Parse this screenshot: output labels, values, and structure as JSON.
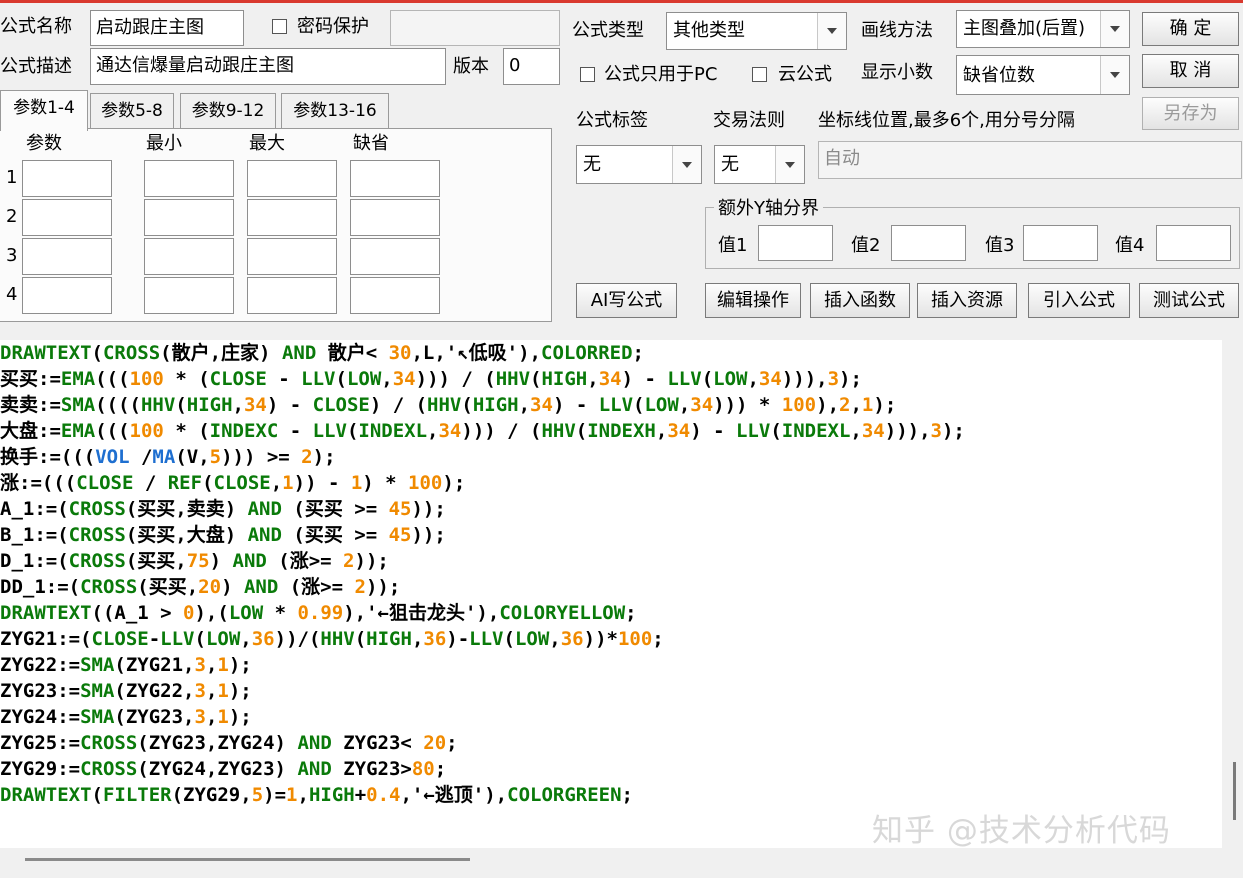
{
  "header": {
    "name_label": "公式名称",
    "name_value": "启动跟庄主图",
    "password_label": "密码保护",
    "desc_label": "公式描述",
    "desc_value": "通达信爆量启动跟庄主图",
    "version_label": "版本",
    "version_value": "0"
  },
  "right_panel": {
    "type_label": "公式类型",
    "type_value": "其他类型",
    "draw_label": "画线方法",
    "draw_value": "主图叠加(后置)",
    "pc_only_label": "公式只用于PC",
    "cloud_label": "云公式",
    "decimals_label": "显示小数",
    "decimals_value": "缺省位数",
    "tag_label": "公式标签",
    "tag_value": "无",
    "rule_label": "交易法则",
    "rule_value": "无",
    "coord_label": "坐标线位置,最多6个,用分号分隔",
    "coord_value": "自动",
    "yaxis_legend": "额外Y轴分界",
    "y1_label": "值1",
    "y2_label": "值2",
    "y3_label": "值3",
    "y4_label": "值4"
  },
  "buttons": {
    "ok": "确  定",
    "cancel": "取  消",
    "save_as": "另存为",
    "ai": "AI写公式",
    "edit": "编辑操作",
    "insert_func": "插入函数",
    "insert_res": "插入资源",
    "import": "引入公式",
    "test": "测试公式"
  },
  "tabs": [
    "参数1-4",
    "参数5-8",
    "参数9-12",
    "参数13-16"
  ],
  "params": {
    "columns": [
      "参数",
      "最小",
      "最大",
      "缺省"
    ],
    "rows": [
      "1",
      "2",
      "3",
      "4"
    ]
  },
  "code_lines": [
    "DRAWTEXT(CROSS(散户,庄家) AND 散户< 30,L,'↖低吸'),COLORRED;",
    "买买:=EMA(((100 * (CLOSE - LLV(LOW,34))) / (HHV(HIGH,34) - LLV(LOW,34))),3);",
    "卖卖:=SMA((((HHV(HIGH,34) - CLOSE) / (HHV(HIGH,34) - LLV(LOW,34))) * 100),2,1);",
    "大盘:=EMA(((100 * (INDEXC - LLV(INDEXL,34))) / (HHV(INDEXH,34) - LLV(INDEXL,34))),3);",
    "换手:=(((VOL /MA(V,5))) >= 2);",
    "涨:=(((CLOSE / REF(CLOSE,1)) - 1) * 100);",
    "A_1:=(CROSS(买买,卖卖) AND (买买 >= 45));",
    "B_1:=(CROSS(买买,大盘) AND (买买 >= 45));",
    "D_1:=(CROSS(买买,75) AND (涨>= 2));",
    "DD_1:=(CROSS(买买,20) AND (涨>= 2));",
    "DRAWTEXT((A_1 > 0),(LOW * 0.99),'←狙击龙头'),COLORYELLOW;",
    "ZYG21:=(CLOSE-LLV(LOW,36))/(HHV(HIGH,36)-LLV(LOW,36))*100;",
    "ZYG22:=SMA(ZYG21,3,1);",
    "ZYG23:=SMA(ZYG22,3,1);",
    "ZYG24:=SMA(ZYG23,3,1);",
    "ZYG25:=CROSS(ZYG23,ZYG24) AND ZYG23< 20;",
    "ZYG29:=CROSS(ZYG24,ZYG23) AND ZYG23>80;",
    "DRAWTEXT(FILTER(ZYG29,5)=1,HIGH+0.4,'←逃顶'),COLORGREEN;"
  ],
  "watermark": "知乎 @技术分析代码",
  "colors": {
    "keyword": "#0a7a0a",
    "number": "#f08a00",
    "builtin_var": "#1e6fd0",
    "top_border": "#d9392e"
  }
}
